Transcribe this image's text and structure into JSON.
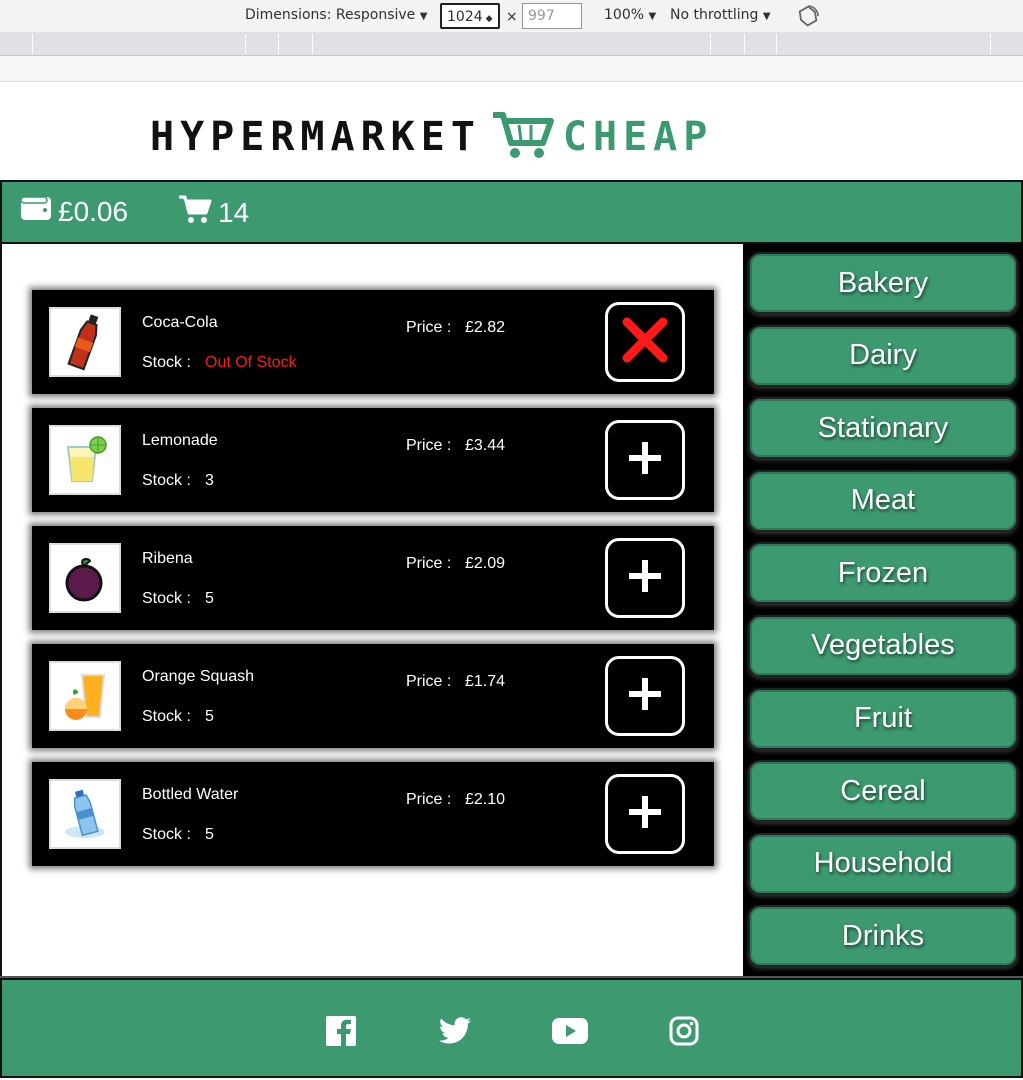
{
  "devtools": {
    "dimensions_label": "Dimensions: Responsive",
    "width": "1024",
    "times": "×",
    "height_placeholder": "997",
    "zoom": "100%",
    "throttling": "No throttling"
  },
  "brand": {
    "word1": "HYPERMARKET",
    "word2": "CHEAP",
    "accent_color": "#3d9970"
  },
  "topbar": {
    "wallet_icon": "wallet-icon",
    "balance": "£0.06",
    "cart_icon": "cart-icon",
    "cart_count": "14"
  },
  "products": [
    {
      "name": "Coca-Cola",
      "stock_label": "Stock :",
      "stock": "Out Of Stock",
      "price_label": "Price :",
      "price": "£2.82",
      "action": "remove-icon",
      "image": "cola-bottle"
    },
    {
      "name": "Lemonade",
      "stock_label": "Stock :",
      "stock": "3",
      "price_label": "Price :",
      "price": "£3.44",
      "action": "plus-icon",
      "image": "lemonade-glass"
    },
    {
      "name": "Ribena",
      "stock_label": "Stock :",
      "stock": "5",
      "price_label": "Price :",
      "price": "£2.09",
      "action": "plus-icon",
      "image": "blackcurrant"
    },
    {
      "name": "Orange Squash",
      "stock_label": "Stock :",
      "stock": "5",
      "price_label": "Price :",
      "price": "£1.74",
      "action": "plus-icon",
      "image": "orange-juice"
    },
    {
      "name": "Bottled Water",
      "stock_label": "Stock :",
      "stock": "5",
      "price_label": "Price :",
      "price": "£2.10",
      "action": "plus-icon",
      "image": "water-bottle"
    }
  ],
  "categories": [
    "Bakery",
    "Dairy",
    "Stationary",
    "Meat",
    "Frozen",
    "Vegetables",
    "Fruit",
    "Cereal",
    "Household",
    "Drinks"
  ],
  "footer": {
    "social": [
      "facebook-icon",
      "twitter-icon",
      "youtube-icon",
      "instagram-icon"
    ]
  }
}
